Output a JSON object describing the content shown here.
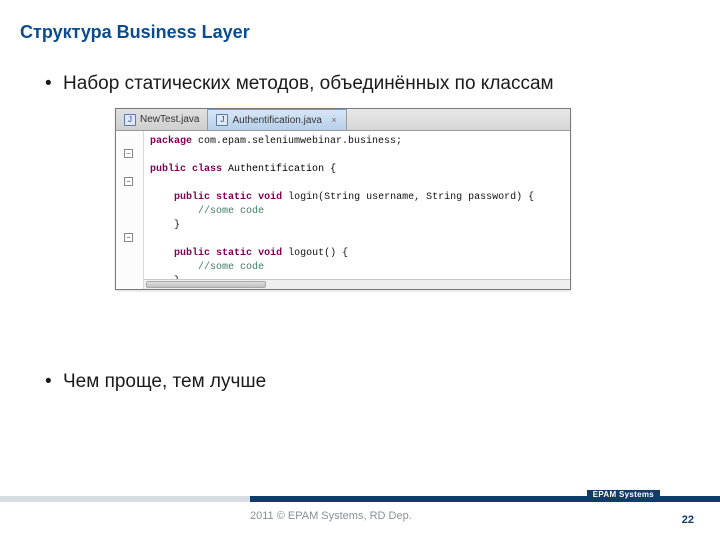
{
  "title": "Структура Business Layer",
  "bullets": {
    "b1": "Набор статических методов, объединённых по классам",
    "b2": "Чем проще, тем лучше"
  },
  "ide": {
    "tabs": {
      "tab1": {
        "label": "NewTest.java"
      },
      "tab2": {
        "label": "Authentification.java"
      }
    },
    "code": {
      "kw_package": "package",
      "pkg": " com.epam.seleniumwebinar.business;",
      "kw_public": "public",
      "kw_class": "class",
      "class_name": " Authentification {",
      "kw_static": "static",
      "kw_void": "void",
      "m1_sig": " login(String username, String password) {",
      "comment": "//some code",
      "brace_close": "}",
      "m2_sig": " logout() {"
    }
  },
  "footer": {
    "brand": "EPAM Systems",
    "copy": "2011 © EPAM Systems, RD Dep.",
    "page": "22"
  }
}
